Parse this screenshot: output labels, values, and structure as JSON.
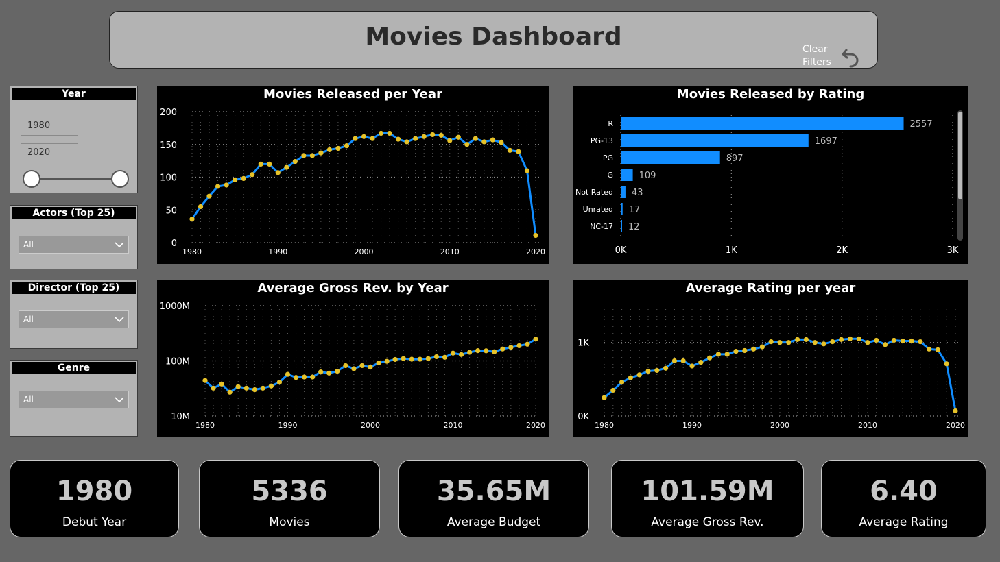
{
  "header": {
    "title": "Movies Dashboard",
    "clear_filters_label": "Clear\nFilters"
  },
  "slicers": {
    "year": {
      "title": "Year",
      "from": "1980",
      "to": "2020"
    },
    "actors": {
      "title": "Actors (Top 25)",
      "value": "All"
    },
    "director": {
      "title": "Director (Top 25)",
      "value": "All"
    },
    "genre": {
      "title": "Genre",
      "value": "All"
    }
  },
  "colors": {
    "line": "#118dff",
    "marker": "#e6c229",
    "bar": "#118dff",
    "grid": "#888888"
  },
  "chart_data": [
    {
      "id": "released_per_year",
      "type": "line",
      "title": "Movies Released per Year",
      "x_ticks": [
        1980,
        1990,
        2000,
        2010,
        2020
      ],
      "y_ticks": [
        "0",
        "50",
        "100",
        "150",
        "200"
      ],
      "ylim": [
        0,
        200
      ],
      "x": [
        1980,
        1981,
        1982,
        1983,
        1984,
        1985,
        1986,
        1987,
        1988,
        1989,
        1990,
        1991,
        1992,
        1993,
        1994,
        1995,
        1996,
        1997,
        1998,
        1999,
        2000,
        2001,
        2002,
        2003,
        2004,
        2005,
        2006,
        2007,
        2008,
        2009,
        2010,
        2011,
        2012,
        2013,
        2014,
        2015,
        2016,
        2017,
        2018,
        2019,
        2020
      ],
      "values": [
        36,
        55,
        71,
        86,
        88,
        96,
        98,
        104,
        120,
        120,
        107,
        115,
        124,
        133,
        133,
        137,
        142,
        144,
        148,
        159,
        162,
        159,
        167,
        167,
        158,
        154,
        159,
        162,
        165,
        164,
        156,
        161,
        150,
        159,
        154,
        157,
        153,
        141,
        139,
        110,
        11
      ]
    },
    {
      "id": "released_by_rating",
      "type": "bar",
      "orientation": "horizontal",
      "title": "Movies Released by Rating",
      "categories": [
        "R",
        "PG-13",
        "PG",
        "G",
        "Not Rated",
        "Unrated",
        "NC-17"
      ],
      "values": [
        2557,
        1697,
        897,
        109,
        43,
        17,
        12
      ],
      "x_ticks": [
        "0K",
        "1K",
        "2K",
        "3K"
      ],
      "xlim": [
        0,
        3000
      ]
    },
    {
      "id": "avg_gross_by_year",
      "type": "line",
      "scale": "log",
      "title": "Average Gross Rev. by Year",
      "x_ticks": [
        1980,
        1990,
        2000,
        2010,
        2020
      ],
      "y_ticks": [
        "10M",
        "100M",
        "1000M"
      ],
      "ylim": [
        10000000,
        1000000000
      ],
      "x": [
        1980,
        1981,
        1982,
        1983,
        1984,
        1985,
        1986,
        1987,
        1988,
        1989,
        1990,
        1991,
        1992,
        1993,
        1994,
        1995,
        1996,
        1997,
        1998,
        1999,
        2000,
        2001,
        2002,
        2003,
        2004,
        2005,
        2006,
        2007,
        2008,
        2009,
        2010,
        2011,
        2012,
        2013,
        2014,
        2015,
        2016,
        2017,
        2018,
        2019,
        2020
      ],
      "values": [
        44000000,
        32000000,
        38000000,
        27000000,
        34000000,
        32000000,
        30000000,
        32000000,
        35000000,
        41000000,
        57000000,
        50000000,
        51000000,
        51000000,
        63000000,
        60000000,
        65000000,
        82000000,
        72000000,
        82000000,
        77000000,
        92000000,
        98000000,
        106000000,
        110000000,
        107000000,
        107000000,
        110000000,
        119000000,
        116000000,
        138000000,
        130000000,
        143000000,
        153000000,
        152000000,
        146000000,
        164000000,
        176000000,
        188000000,
        200000000,
        248000000
      ]
    },
    {
      "id": "avg_rating_per_year",
      "type": "line",
      "title": "Average Rating per year",
      "x_ticks": [
        1980,
        1990,
        2000,
        2010,
        2020
      ],
      "y_ticks": [
        "0K",
        "1K"
      ],
      "ylim": [
        0,
        1500
      ],
      "x": [
        1980,
        1981,
        1982,
        1983,
        1984,
        1985,
        1986,
        1987,
        1988,
        1989,
        1990,
        1991,
        1992,
        1993,
        1994,
        1995,
        1996,
        1997,
        1998,
        1999,
        2000,
        2001,
        2002,
        2003,
        2004,
        2005,
        2006,
        2007,
        2008,
        2009,
        2010,
        2011,
        2012,
        2013,
        2014,
        2015,
        2016,
        2017,
        2018,
        2019,
        2020
      ],
      "values": [
        250,
        350,
        460,
        520,
        560,
        610,
        620,
        650,
        750,
        750,
        680,
        730,
        790,
        840,
        840,
        880,
        890,
        910,
        940,
        1010,
        1000,
        1000,
        1040,
        1040,
        1000,
        980,
        1010,
        1040,
        1050,
        1050,
        1000,
        1030,
        970,
        1030,
        1020,
        1020,
        1010,
        910,
        900,
        710,
        70
      ]
    }
  ],
  "kpis": [
    {
      "value": "1980",
      "label": "Debut Year"
    },
    {
      "value": "5336",
      "label": "Movies"
    },
    {
      "value": "35.65M",
      "label": "Average Budget"
    },
    {
      "value": "101.59M",
      "label": "Average Gross Rev."
    },
    {
      "value": "6.40",
      "label": "Average Rating"
    }
  ]
}
